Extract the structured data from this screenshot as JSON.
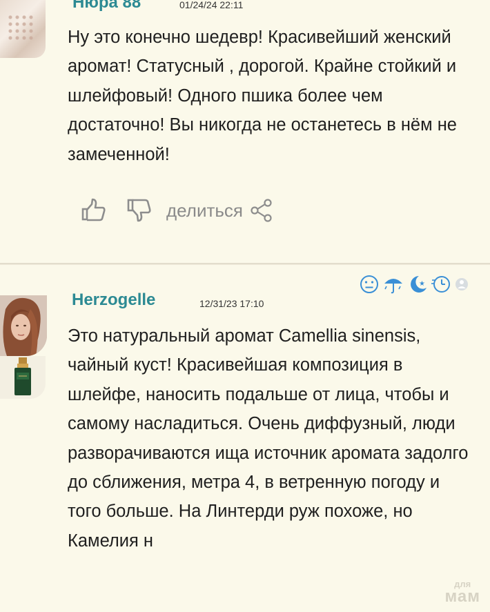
{
  "comments": [
    {
      "username": "Нюра 88",
      "date": "01/24/24 22:11",
      "text": "Ну это конечно шедевр! Красивейший женский аромат! Статусный , дорогой. Крайне стойкий и шлейфовый! Одного пшика более чем достаточно! Вы никогда не останетесь в нём не замеченной!",
      "actions": {
        "like_icon": "thumb-up-icon",
        "dislike_icon": "thumb-down-icon",
        "share_label": "делиться",
        "share_icon": "share-icon"
      }
    },
    {
      "username": "Herzogelle",
      "date": "12/31/23 17:10",
      "text": "Это натуральный аромат Camellia sinensis, чайный куст! Красивейшая композиция в шлейфе, наносить подальше от лица, чтобы и самому насладиться. Очень диффузный, люди разворачиваются ища источник аромата задолго до сближения, метра 4, в ветренную погоду и того больше. На Линтерди руж похоже, но Камелия н",
      "status_icons": [
        "smiley-neutral-icon",
        "umbrella-rain-icon",
        "moon-stars-icon",
        "clock-icon",
        "hidden-circle-icon"
      ]
    }
  ],
  "watermark": {
    "line1": "для",
    "line2": "мам"
  },
  "colors": {
    "background": "#fbf9ea",
    "username": "#2c8a93",
    "icon_blue": "#3a8fd6",
    "icon_gray": "#8d8d8d"
  }
}
